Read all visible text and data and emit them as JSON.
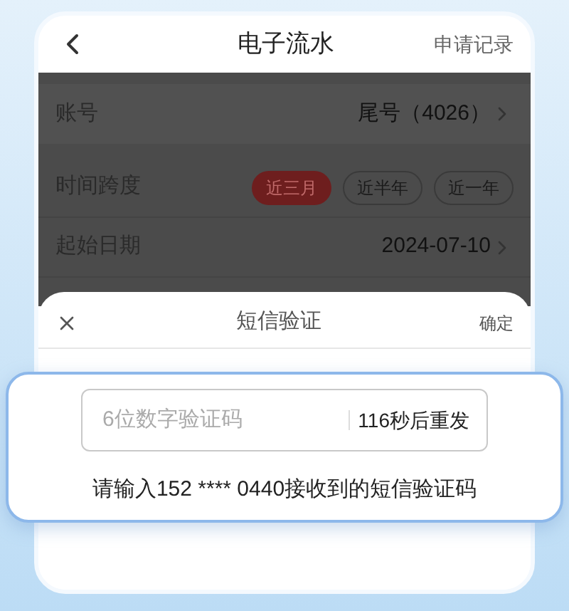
{
  "header": {
    "title": "电子流水",
    "action": "申请记录"
  },
  "rows": [
    {
      "kind": "value",
      "label": "账号",
      "value": "尾号（4026）"
    },
    {
      "kind": "chips",
      "label": "时间跨度",
      "chips": [
        {
          "label": "近三月",
          "selected": true
        },
        {
          "label": "近半年",
          "selected": false
        },
        {
          "label": "近一年",
          "selected": false
        }
      ]
    },
    {
      "kind": "value",
      "label": "起始日期",
      "value": "2024-07-10"
    }
  ],
  "sheet": {
    "title": "短信验证",
    "confirm": "确定",
    "code_field": {
      "placeholder": "6位数字验证码"
    },
    "resend": "116秒后重发",
    "hint": "请输入152 **** 0440接收到的短信验证码"
  }
}
